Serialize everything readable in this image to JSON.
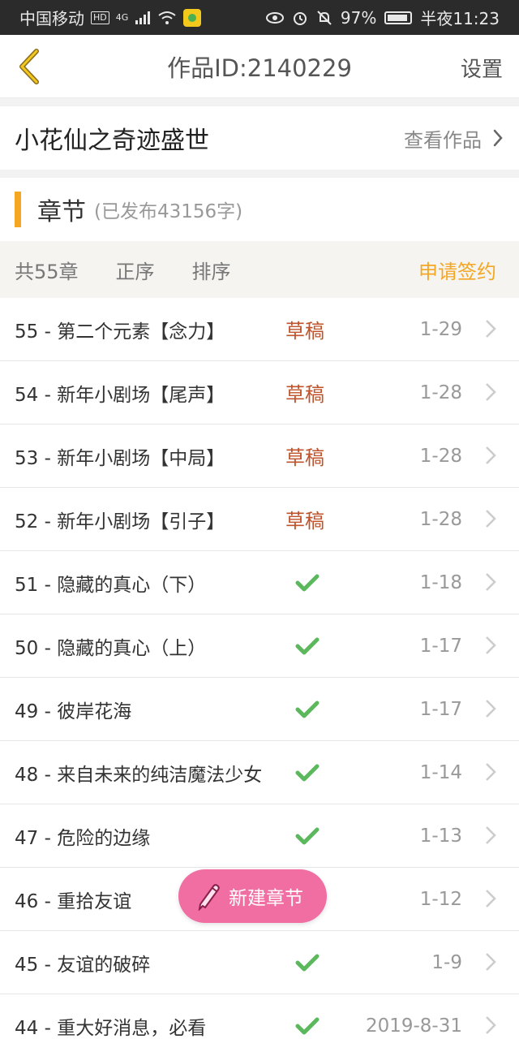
{
  "status_bar": {
    "carrier": "中国移动",
    "hd": "HD",
    "network": "4G",
    "battery": "97%",
    "time": "半夜11:23"
  },
  "header": {
    "title": "作品ID:2140229",
    "settings_label": "设置"
  },
  "work": {
    "title": "小花仙之奇迹盛世",
    "view_label": "查看作品"
  },
  "chapters_section": {
    "title": "章节",
    "subtitle": "(已发布43156字)"
  },
  "toolbar": {
    "count": "共55章",
    "order": "正序",
    "sort": "排序",
    "sign": "申请签约"
  },
  "chapters": [
    {
      "title": "55 - 第二个元素【念力】",
      "status": "草稿",
      "date": "1-29",
      "published": false
    },
    {
      "title": "54 - 新年小剧场【尾声】",
      "status": "草稿",
      "date": "1-28",
      "published": false
    },
    {
      "title": "53 - 新年小剧场【中局】",
      "status": "草稿",
      "date": "1-28",
      "published": false
    },
    {
      "title": "52 - 新年小剧场【引子】",
      "status": "草稿",
      "date": "1-28",
      "published": false
    },
    {
      "title": "51 - 隐藏的真心（下）",
      "status": "",
      "date": "1-18",
      "published": true
    },
    {
      "title": "50 - 隐藏的真心（上）",
      "status": "",
      "date": "1-17",
      "published": true
    },
    {
      "title": "49 - 彼岸花海",
      "status": "",
      "date": "1-17",
      "published": true
    },
    {
      "title": "48 - 来自未来的纯洁魔法少女",
      "status": "",
      "date": "1-14",
      "published": true
    },
    {
      "title": "47 - 危险的边缘",
      "status": "",
      "date": "1-13",
      "published": true
    },
    {
      "title": "46 - 重拾友谊",
      "status": "",
      "date": "1-12",
      "published": true
    },
    {
      "title": "45 - 友谊的破碎",
      "status": "",
      "date": "1-9",
      "published": true
    },
    {
      "title": "44 - 重大好消息，必看",
      "status": "",
      "date": "2019-8-31",
      "published": true
    }
  ],
  "fab": {
    "label": "新建章节"
  },
  "colors": {
    "accent": "#f5a623",
    "draft": "#c0532b",
    "check": "#5cb85c",
    "fab": "#f06ea2"
  }
}
